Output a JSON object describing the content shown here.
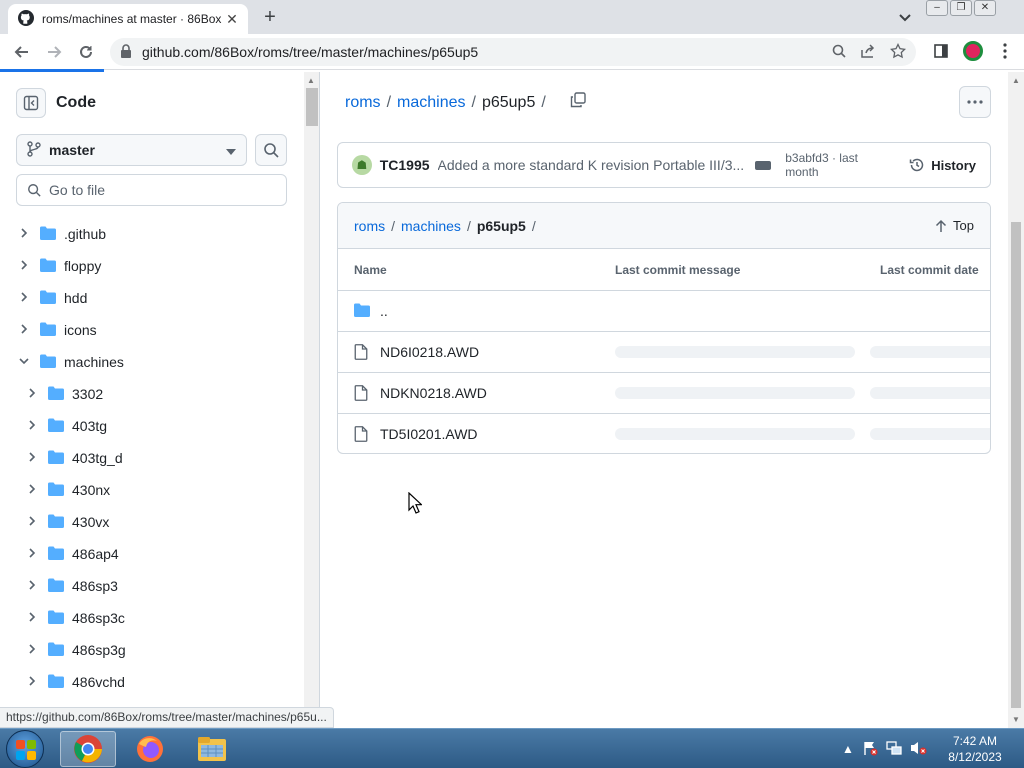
{
  "browser": {
    "tab_title": "roms/machines at master · 86Box",
    "new_tab": "+",
    "url": "github.com/86Box/roms/tree/master/machines/p65up5",
    "status_url": "https://github.com/86Box/roms/tree/master/machines/p65u..."
  },
  "sidebar": {
    "title": "Code",
    "branch": "master",
    "goto_placeholder": "Go to file",
    "items": [
      {
        "label": ".github",
        "expanded": false,
        "depth": 0
      },
      {
        "label": "floppy",
        "expanded": false,
        "depth": 0
      },
      {
        "label": "hdd",
        "expanded": false,
        "depth": 0
      },
      {
        "label": "icons",
        "expanded": false,
        "depth": 0
      },
      {
        "label": "machines",
        "expanded": true,
        "depth": 0
      },
      {
        "label": "3302",
        "expanded": false,
        "depth": 1
      },
      {
        "label": "403tg",
        "expanded": false,
        "depth": 1
      },
      {
        "label": "403tg_d",
        "expanded": false,
        "depth": 1
      },
      {
        "label": "430nx",
        "expanded": false,
        "depth": 1
      },
      {
        "label": "430vx",
        "expanded": false,
        "depth": 1
      },
      {
        "label": "486ap4",
        "expanded": false,
        "depth": 1
      },
      {
        "label": "486sp3",
        "expanded": false,
        "depth": 1
      },
      {
        "label": "486sp3c",
        "expanded": false,
        "depth": 1
      },
      {
        "label": "486sp3g",
        "expanded": false,
        "depth": 1
      },
      {
        "label": "486vchd",
        "expanded": false,
        "depth": 1
      }
    ]
  },
  "main": {
    "breadcrumb": {
      "root": "roms",
      "mid": "machines",
      "current": "p65up5",
      "sep": "/"
    },
    "commit": {
      "author": "TC1995",
      "message": "Added a more standard K revision Portable III/3...",
      "hash": "b3abfd3 · last month",
      "history_label": "History"
    },
    "table": {
      "top_label": "Top",
      "columns": {
        "name": "Name",
        "message": "Last commit message",
        "date": "Last commit date"
      },
      "parent": "..",
      "files": [
        "ND6I0218.AWD",
        "NDKN0218.AWD",
        "TD5I0201.AWD"
      ]
    }
  },
  "taskbar": {
    "time": "7:42 AM",
    "date": "8/12/2023"
  },
  "colors": {
    "link": "#0969da",
    "folder": "#54aeff",
    "accent_profile": "#e0245e"
  }
}
